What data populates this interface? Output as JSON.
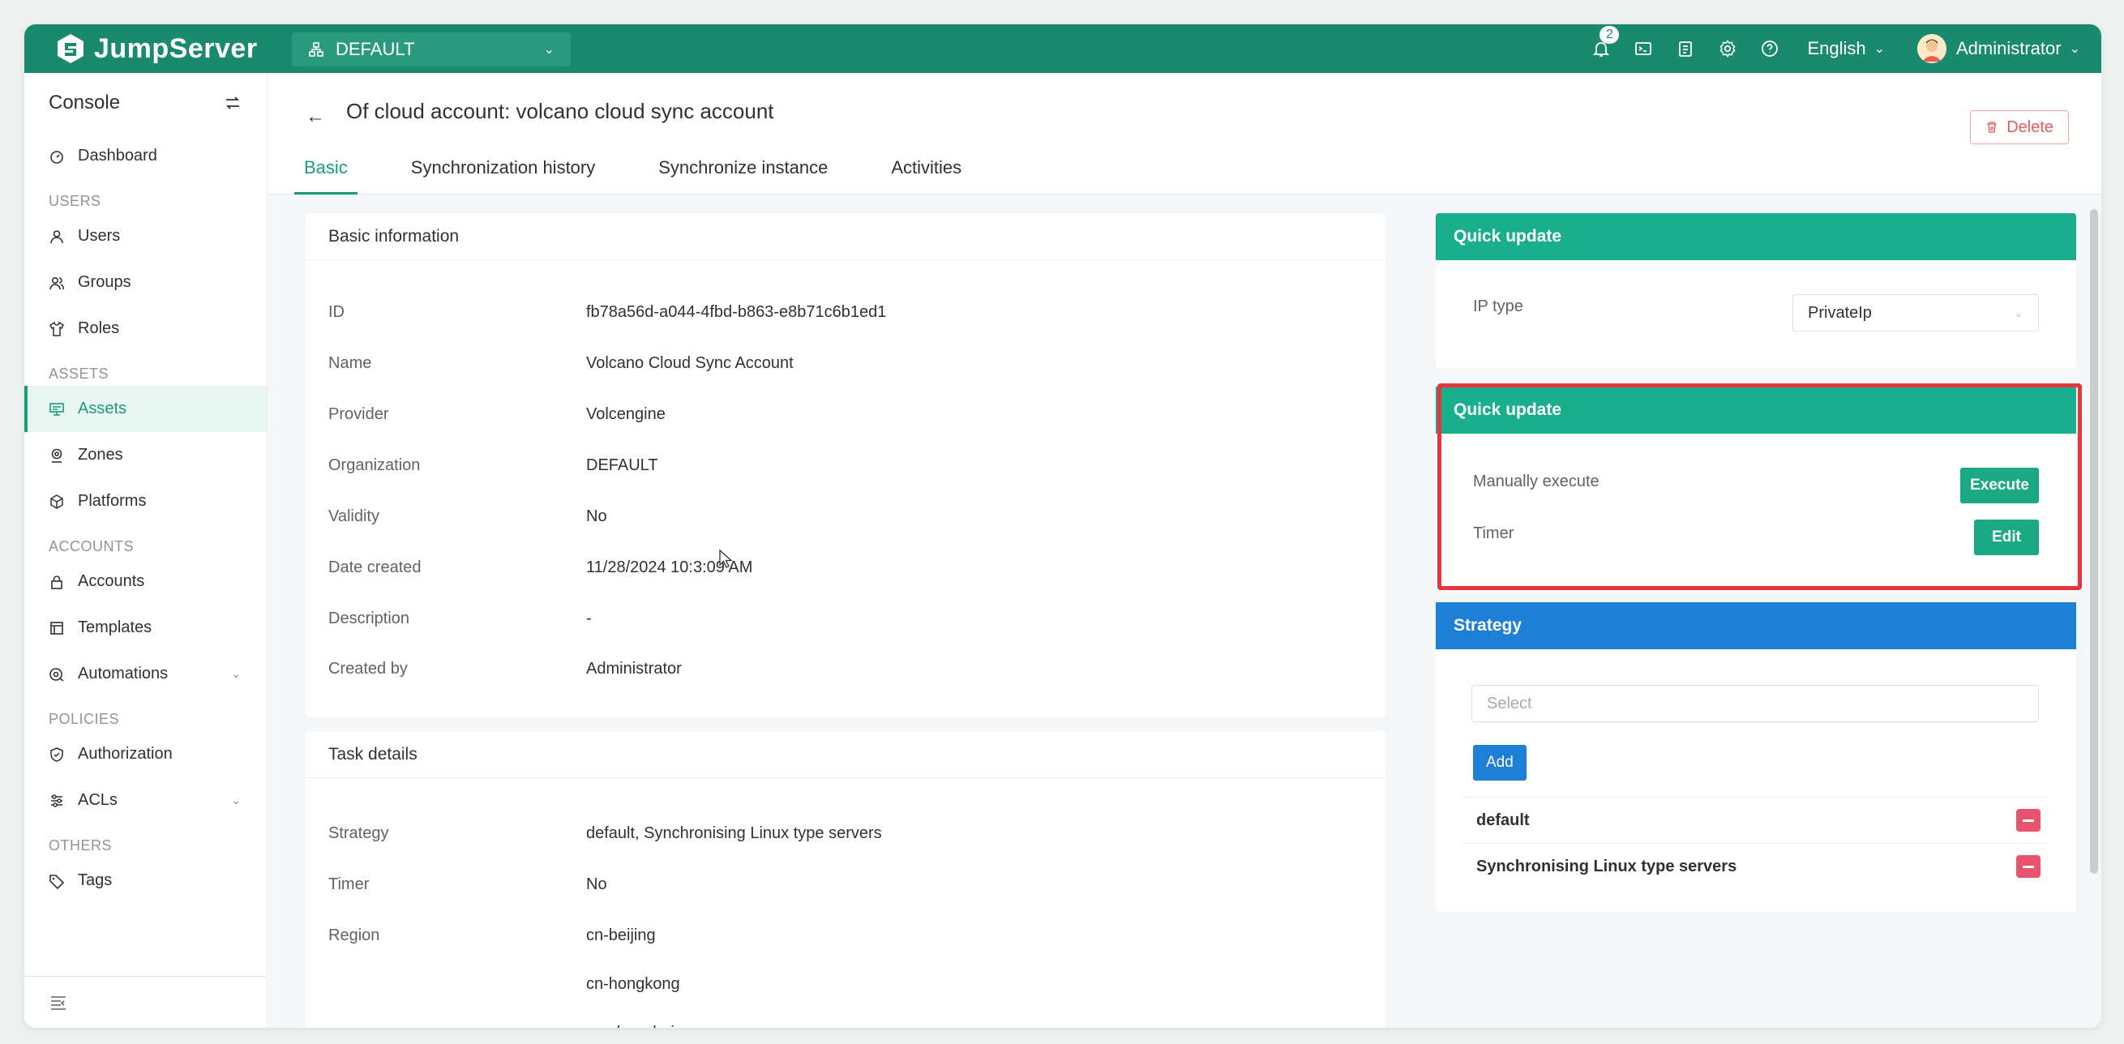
{
  "app": {
    "name": "JumpServer",
    "org": "DEFAULT",
    "notification_count": "2",
    "language": "English",
    "user": "Administrator"
  },
  "colors": {
    "brand": "#1a8a6e",
    "accent": "#1a9b7c",
    "quick_update_header": "#1aaf8c",
    "strategy_header": "#1e7fd6",
    "danger": "#e25c5c",
    "highlight": "#e5353f"
  },
  "sidebar": {
    "title": "Console",
    "groups": {
      "users": "USERS",
      "assets": "ASSETS",
      "accounts": "ACCOUNTS",
      "policies": "POLICIES",
      "others": "OTHERS"
    },
    "items": {
      "dashboard": "Dashboard",
      "users": "Users",
      "groups": "Groups",
      "roles": "Roles",
      "assets": "Assets",
      "zones": "Zones",
      "platforms": "Platforms",
      "accounts": "Accounts",
      "templates": "Templates",
      "automations": "Automations",
      "authorization": "Authorization",
      "acls": "ACLs",
      "tags": "Tags"
    },
    "active": "assets"
  },
  "page": {
    "title": "Of cloud account: volcano cloud sync account",
    "delete_label": "Delete",
    "tabs": [
      "Basic",
      "Synchronization history",
      "Synchronize instance",
      "Activities"
    ],
    "active_tab": 0
  },
  "basic_info": {
    "header": "Basic information",
    "rows": [
      {
        "label": "ID",
        "value": "fb78a56d-a044-4fbd-b863-e8b71c6b1ed1"
      },
      {
        "label": "Name",
        "value": "Volcano Cloud Sync Account"
      },
      {
        "label": "Provider",
        "value": "Volcengine"
      },
      {
        "label": "Organization",
        "value": "DEFAULT"
      },
      {
        "label": "Validity",
        "value": "No"
      },
      {
        "label": "Date created",
        "value": "11/28/2024 10:3:09 AM"
      },
      {
        "label": "Description",
        "value": "-"
      },
      {
        "label": "Created by",
        "value": "Administrator"
      }
    ]
  },
  "task_details": {
    "header": "Task details",
    "strategy_label": "Strategy",
    "strategy_value": "default, Synchronising Linux type servers",
    "timer_label": "Timer",
    "timer_value": "No",
    "region_label": "Region",
    "regions": [
      "cn-beijing",
      "cn-hongkong",
      "cn-shanghai"
    ]
  },
  "quick_update_1": {
    "header": "Quick update",
    "ip_type_label": "IP type",
    "ip_type_value": "PrivateIp"
  },
  "quick_update_2": {
    "header": "Quick update",
    "manual_label": "Manually execute",
    "execute_label": "Execute",
    "timer_label": "Timer",
    "edit_label": "Edit"
  },
  "strategy": {
    "header": "Strategy",
    "select_placeholder": "Select",
    "add_label": "Add",
    "items": [
      "default",
      "Synchronising Linux type servers"
    ]
  }
}
